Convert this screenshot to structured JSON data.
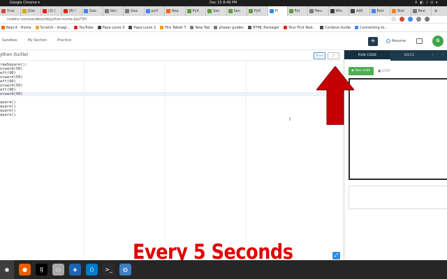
{
  "os_bar": {
    "app_name": "Google Chrome ▾",
    "clock": "Dec 15  8:49 PM",
    "system_icons": "⚲ ◧ ♪ ⏻ ▾"
  },
  "tabs": [
    {
      "label": "Ycar",
      "color": "#d14836"
    },
    {
      "label": "[Gar",
      "color": "#e0a400"
    },
    {
      "label": "(3) I",
      "color": "#e62117"
    },
    {
      "label": "(6) I",
      "color": "#e62117"
    },
    {
      "label": "Goo",
      "color": "#4285f4"
    },
    {
      "label": "Van",
      "color": "#7a7a7a"
    },
    {
      "label": "Gea",
      "color": "#7a7a7a"
    },
    {
      "label": "pytl",
      "color": "#4285f4"
    },
    {
      "label": "Rep",
      "color": "#f26207"
    },
    {
      "label": "Pytl",
      "color": "#5a9e3a"
    },
    {
      "label": "San",
      "color": "#5a9e3a"
    },
    {
      "label": "San",
      "color": "#5a9e3a"
    },
    {
      "label": "Pytl",
      "color": "#5a9e3a"
    },
    {
      "label": "Pl",
      "color": "#2e8be0",
      "active": true
    },
    {
      "label": "Pyt",
      "color": "#5a9e3a"
    },
    {
      "label": "Neu",
      "color": "#7a7a7a"
    },
    {
      "label": "Win",
      "color": "#3a3a3a"
    },
    {
      "label": "Adil",
      "color": "#444444"
    },
    {
      "label": "Extr",
      "color": "#4285f4"
    },
    {
      "label": "Stal",
      "color": "#f48024"
    },
    {
      "label": "Resi",
      "color": "#7a7a7a"
    }
  ],
  "new_tab_label": "+",
  "address": {
    "url": "codehs.com/sandbox/id/python-turtle-bsLF3H",
    "nav_icons": "← → ⟳"
  },
  "bookmarks": [
    {
      "label": "Repl.it - Home",
      "color": "#f26207"
    },
    {
      "label": "Scratch - Imagi...",
      "color": "#f5a623"
    },
    {
      "label": "YouTube",
      "color": "#e62117"
    },
    {
      "label": "Papa Louie 3",
      "color": "#444444"
    },
    {
      "label": "Papa Louie 2",
      "color": "#444444"
    },
    {
      "label": "Fire Tablet 7",
      "color": "#ff9900"
    },
    {
      "label": "New Tab",
      "color": "#7a7a7a"
    },
    {
      "label": "phaser guides",
      "color": "#7a7a7a"
    },
    {
      "label": "HTML Packager",
      "color": "#555555"
    },
    {
      "label": "Your First Nod...",
      "color": "#e62117"
    },
    {
      "label": "Cordova Guide",
      "color": "#4a4a4a"
    },
    {
      "label": "Connecting to...",
      "color": "#4285f4"
    }
  ],
  "app_nav": [
    "Sandbox",
    "My Section",
    "Practice"
  ],
  "header_actions": {
    "plus": "+",
    "resume": "Resume",
    "avatar_initial": "G"
  },
  "editor": {
    "title": "ython (turtle)",
    "share_label": "Share",
    "expand_label": "⤢",
    "code_lines": [
      "rawSquare():",
      "orward(50)",
      "eft(90)",
      "orward(50)",
      "eft(90)",
      "orward(50)",
      "eft(90)",
      "orward(50)",
      "",
      "quare()",
      "quare()",
      "quare()",
      "quare()"
    ],
    "active_line": 7,
    "fullscreen_icon": "⤢",
    "cursor_glyph": "I"
  },
  "overlay": {
    "caption": "Every 5 Seconds",
    "arrow_color": "#c40000"
  },
  "right_panel": {
    "tabs": [
      "RUN CODE",
      "DOCS",
      "⋮",
      "⋮"
    ],
    "run_label": "▶ Run Code",
    "stop_label": "■ STOP"
  },
  "dock": [
    {
      "name": "system-icon",
      "glyph": "◉",
      "color": "#3d3d3d"
    },
    {
      "name": "firefox-icon",
      "glyph": "●",
      "color": "#e66000"
    },
    {
      "name": "intellij-icon",
      "glyph": "IJ",
      "color": "#000000"
    },
    {
      "name": "files-icon",
      "glyph": "▭",
      "color": "#a9a9a9"
    },
    {
      "name": "virtualbox-icon",
      "glyph": "◈",
      "color": "#1e64b4"
    },
    {
      "name": "vscode-icon",
      "glyph": "⟨⟩",
      "color": "#007acc"
    },
    {
      "name": "terminal-icon",
      "glyph": ">_",
      "color": "#2c2c2c"
    },
    {
      "name": "globe-icon",
      "glyph": "◍",
      "color": "#3f7fbf"
    }
  ]
}
